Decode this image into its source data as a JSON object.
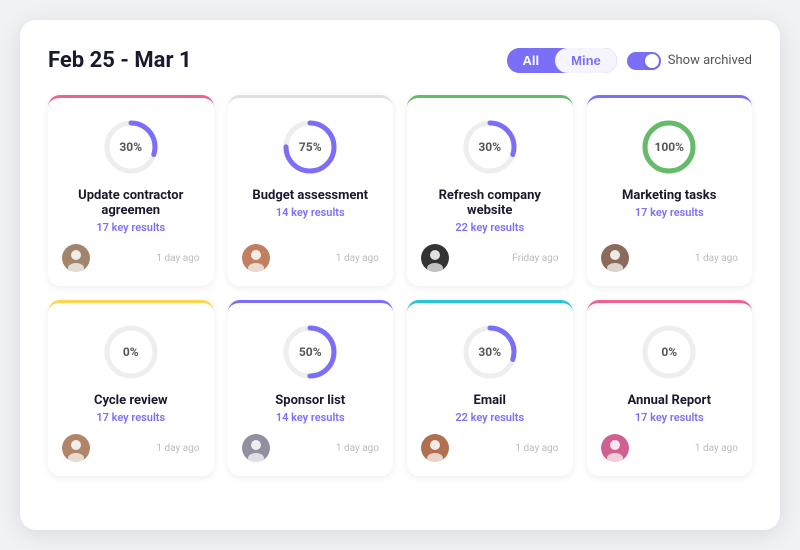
{
  "header": {
    "title": "Feb 25 - Mar 1",
    "filter_all": "All",
    "filter_mine": "Mine",
    "toggle_label": "Show archived"
  },
  "cards": [
    {
      "id": "card-1",
      "title": "Update contractor agreemen",
      "subtext": "17 key results",
      "percent": 30,
      "border_color": "#f06292",
      "stroke_color": "#7c6ff7",
      "time": "1 day ago",
      "avatar_color": "#a0856c",
      "avatar_initials": "👤"
    },
    {
      "id": "card-2",
      "title": "Budget assessment",
      "subtext": "14 key results",
      "percent": 75,
      "border_color": "#e0e0e0",
      "stroke_color": "#7c6ff7",
      "time": "1 day ago",
      "avatar_color": "#c08060",
      "avatar_initials": "👤"
    },
    {
      "id": "card-3",
      "title": "Refresh company website",
      "subtext": "22 key results",
      "percent": 30,
      "border_color": "#66bb6a",
      "stroke_color": "#7c6ff7",
      "time": "Friday ago",
      "avatar_color": "#333",
      "avatar_initials": "👤"
    },
    {
      "id": "card-4",
      "title": "Marketing tasks",
      "subtext": "17 key results",
      "percent": 100,
      "border_color": "#7c6ff7",
      "stroke_color": "#66bb6a",
      "time": "1 day ago",
      "avatar_color": "#8b6a5a",
      "avatar_initials": "👤"
    },
    {
      "id": "card-5",
      "title": "Cycle review",
      "subtext": "17 key results",
      "percent": 0,
      "border_color": "#ffd54f",
      "stroke_color": "#7c6ff7",
      "time": "1 day ago",
      "avatar_color": "#b0856a",
      "avatar_initials": "👤"
    },
    {
      "id": "card-6",
      "title": "Sponsor list",
      "subtext": "14 key results",
      "percent": 50,
      "border_color": "#7c6ff7",
      "stroke_color": "#7c6ff7",
      "time": "1 day ago",
      "avatar_color": "#9090a0",
      "avatar_initials": "👤"
    },
    {
      "id": "card-7",
      "title": "Email",
      "subtext": "22 key results",
      "percent": 30,
      "border_color": "#26c6da",
      "stroke_color": "#7c6ff7",
      "time": "1 day ago",
      "avatar_color": "#b07050",
      "avatar_initials": "👤"
    },
    {
      "id": "card-8",
      "title": "Annual Report",
      "subtext": "17 key results",
      "percent": 0,
      "border_color": "#f06292",
      "stroke_color": "#7c6ff7",
      "time": "1 day ago",
      "avatar_color": "#d06090",
      "avatar_initials": "👤"
    }
  ]
}
